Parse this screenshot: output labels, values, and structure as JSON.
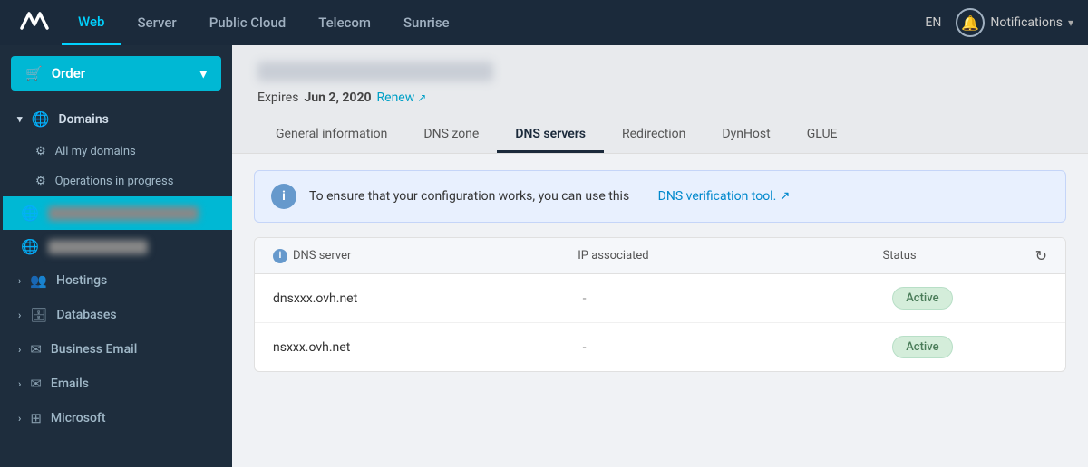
{
  "nav": {
    "items": [
      {
        "label": "Web",
        "active": true
      },
      {
        "label": "Server",
        "active": false
      },
      {
        "label": "Public Cloud",
        "active": false
      },
      {
        "label": "Telecom",
        "active": false
      },
      {
        "label": "Sunrise",
        "active": false
      }
    ],
    "lang": "EN",
    "notifications_label": "Notifications"
  },
  "sidebar": {
    "order_label": "Order",
    "domains_label": "Domains",
    "all_domains_label": "All my domains",
    "operations_label": "Operations in progress",
    "domain_active": "██████████████████",
    "domain_second": "████████████",
    "hostings_label": "Hostings",
    "databases_label": "Databases",
    "business_email_label": "Business Email",
    "emails_label": "Emails",
    "microsoft_label": "Microsoft"
  },
  "domain": {
    "expires_text": "Expires",
    "expires_date": "Jun 2, 2020",
    "renew_label": "Renew"
  },
  "tabs": [
    {
      "label": "General information",
      "active": false
    },
    {
      "label": "DNS zone",
      "active": false
    },
    {
      "label": "DNS servers",
      "active": true
    },
    {
      "label": "Redirection",
      "active": false
    },
    {
      "label": "DynHost",
      "active": false
    },
    {
      "label": "GLUE",
      "active": false
    }
  ],
  "info_banner": {
    "text": "To ensure that your configuration works, you can use this",
    "link_text": "DNS verification tool.",
    "link_icon": "↗"
  },
  "dns_table": {
    "col_server": "DNS server",
    "col_ip": "IP associated",
    "col_status": "Status",
    "rows": [
      {
        "server": "dnsxxx.ovh.net",
        "ip": "-",
        "status": "Active"
      },
      {
        "server": "nsxxx.ovh.net",
        "ip": "-",
        "status": "Active"
      }
    ]
  }
}
